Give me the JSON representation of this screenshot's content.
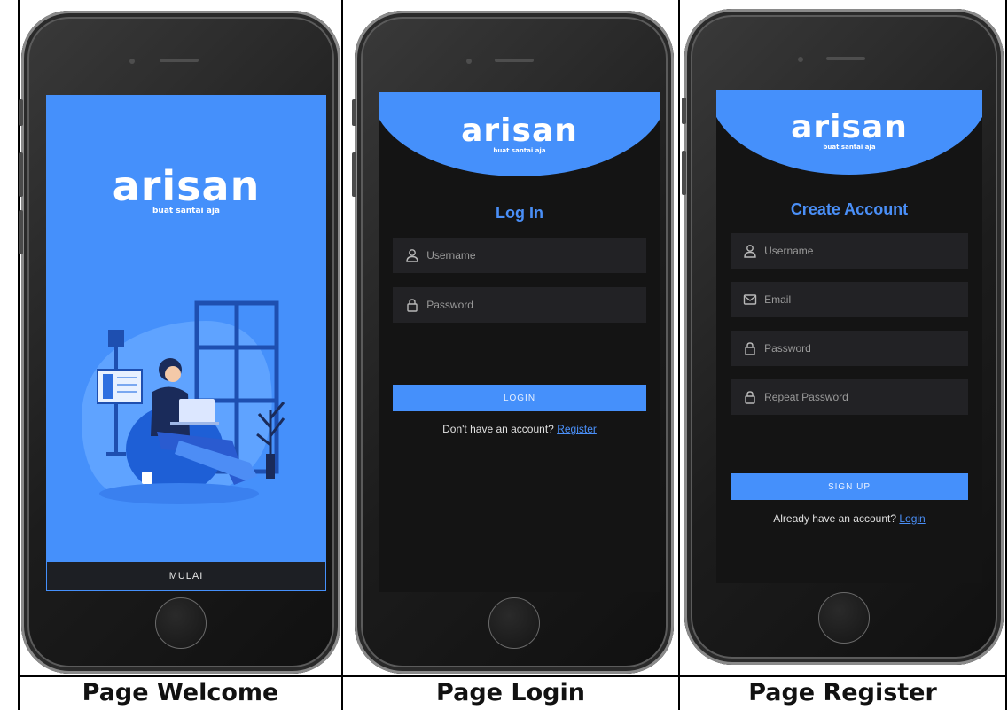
{
  "captions": {
    "welcome": "Page Welcome",
    "login": "Page Login",
    "register": "Page Register"
  },
  "brand": {
    "name": "arisan",
    "tagline": "buat santai aja"
  },
  "welcome": {
    "start_button": "MULAI",
    "illustration": "person-on-beanbag-with-laptop-illustration"
  },
  "login": {
    "title": "Log In",
    "username_placeholder": "Username",
    "password_placeholder": "Password",
    "login_button": "LOGIN",
    "prompt": "Don't have an account?",
    "register_link": "Register"
  },
  "register": {
    "title": "Create Account",
    "username_placeholder": "Username",
    "email_placeholder": "Email",
    "password_placeholder": "Password",
    "repeat_password_placeholder": "Repeat Password",
    "signup_button": "SIGN UP",
    "prompt": "Already have an account?",
    "login_link": "Login"
  },
  "colors": {
    "primary_blue": "#4590fb",
    "dark_background": "#141414",
    "field_background": "#222225"
  },
  "icons": {
    "username": "user-icon",
    "email": "mail-icon",
    "password": "lock-icon"
  }
}
